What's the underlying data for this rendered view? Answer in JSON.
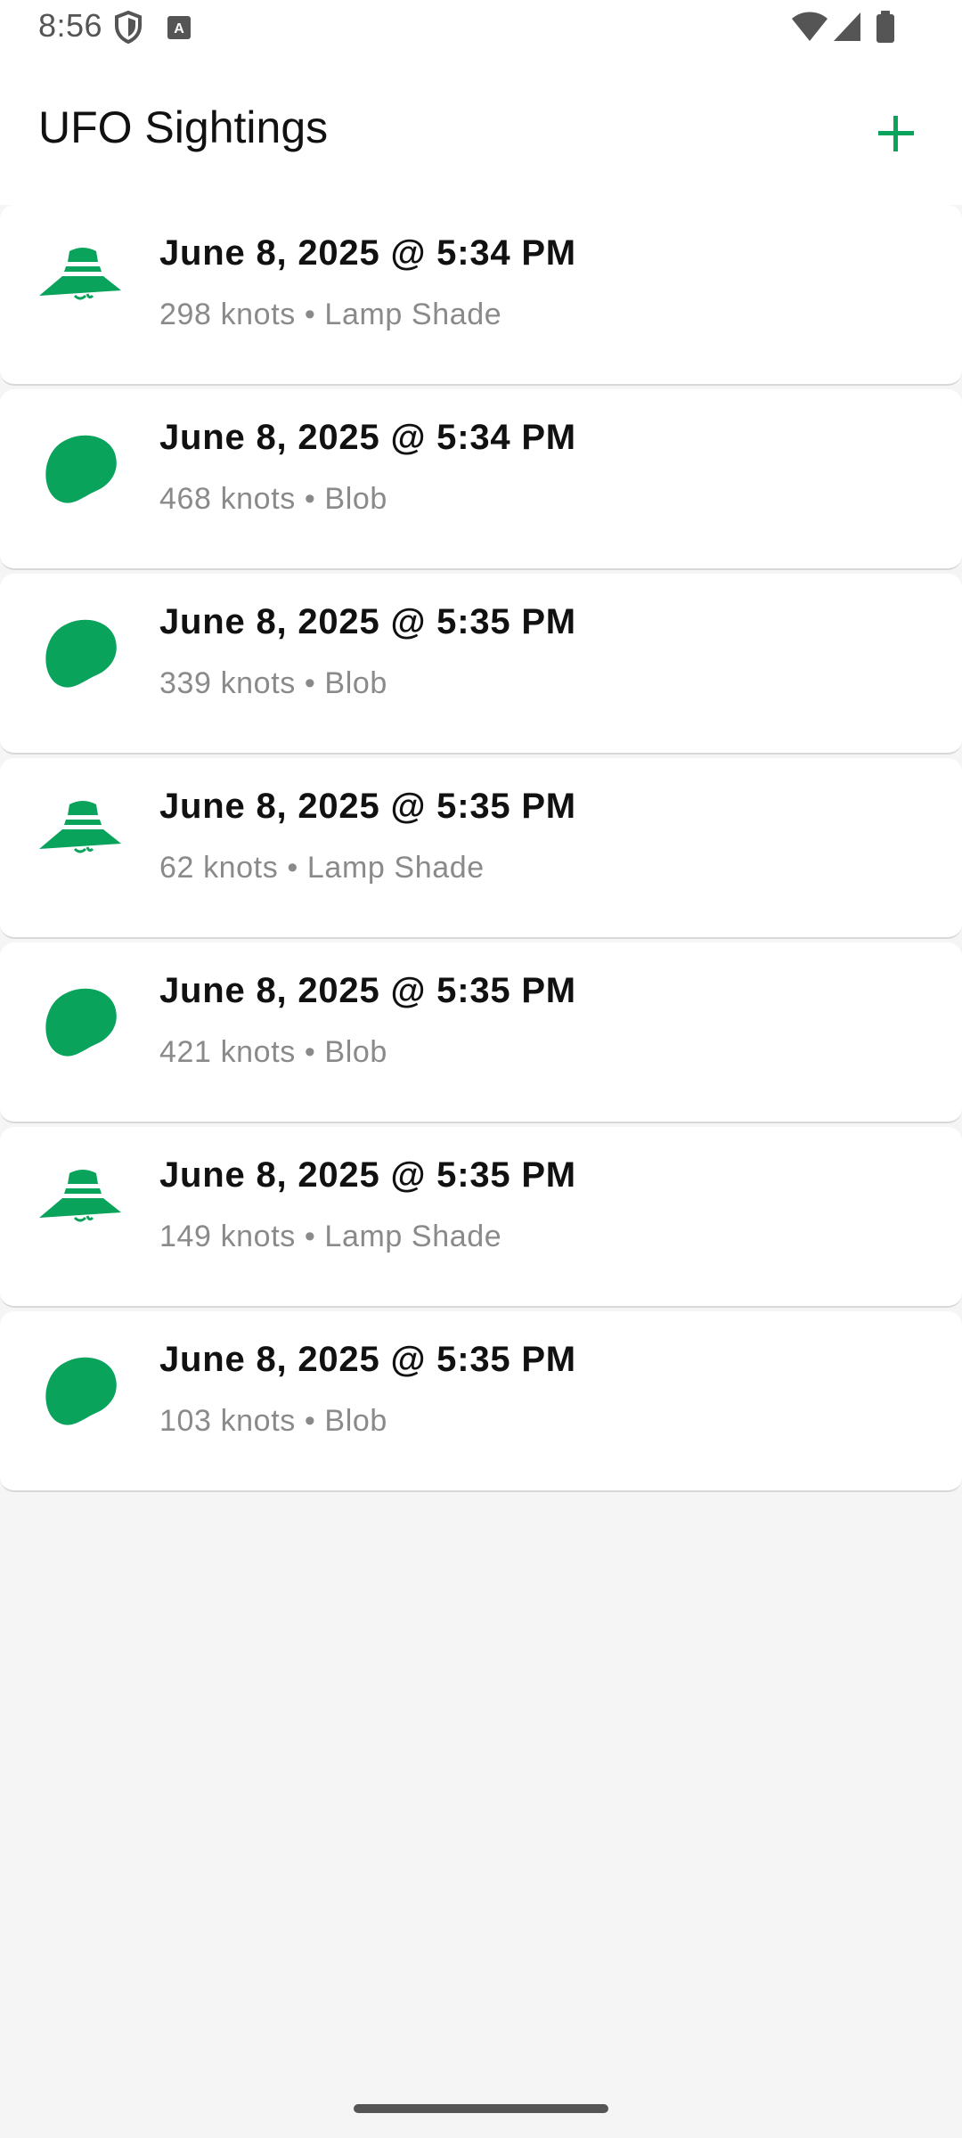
{
  "status_bar": {
    "time": "8:56",
    "left_icons": [
      "shield-icon",
      "keyboard-a-icon"
    ],
    "right_icons": [
      "wifi-icon",
      "cell-signal-icon",
      "battery-icon"
    ]
  },
  "app_bar": {
    "title": "UFO Sightings",
    "add_icon": "plus-icon"
  },
  "colors": {
    "accent": "#0aa35c",
    "background": "#f5f5f5",
    "card": "#ffffff",
    "title_text": "#111111",
    "sub_text": "#8a8a8a"
  },
  "sightings": [
    {
      "title": "June 8, 2025 @ 5:34 PM",
      "subtitle": "298 knots • Lamp Shade",
      "icon": "lamp-shade-ufo-icon"
    },
    {
      "title": "June 8, 2025 @ 5:34 PM",
      "subtitle": "468 knots • Blob",
      "icon": "blob-ufo-icon"
    },
    {
      "title": "June 8, 2025 @ 5:35 PM",
      "subtitle": "339 knots • Blob",
      "icon": "blob-ufo-icon"
    },
    {
      "title": "June 8, 2025 @ 5:35 PM",
      "subtitle": "62 knots • Lamp Shade",
      "icon": "lamp-shade-ufo-icon"
    },
    {
      "title": "June 8, 2025 @ 5:35 PM",
      "subtitle": "421 knots • Blob",
      "icon": "blob-ufo-icon"
    },
    {
      "title": "June 8, 2025 @ 5:35 PM",
      "subtitle": "149 knots • Lamp Shade",
      "icon": "lamp-shade-ufo-icon"
    },
    {
      "title": "June 8, 2025 @ 5:35 PM",
      "subtitle": "103 knots • Blob",
      "icon": "blob-ufo-icon"
    }
  ]
}
